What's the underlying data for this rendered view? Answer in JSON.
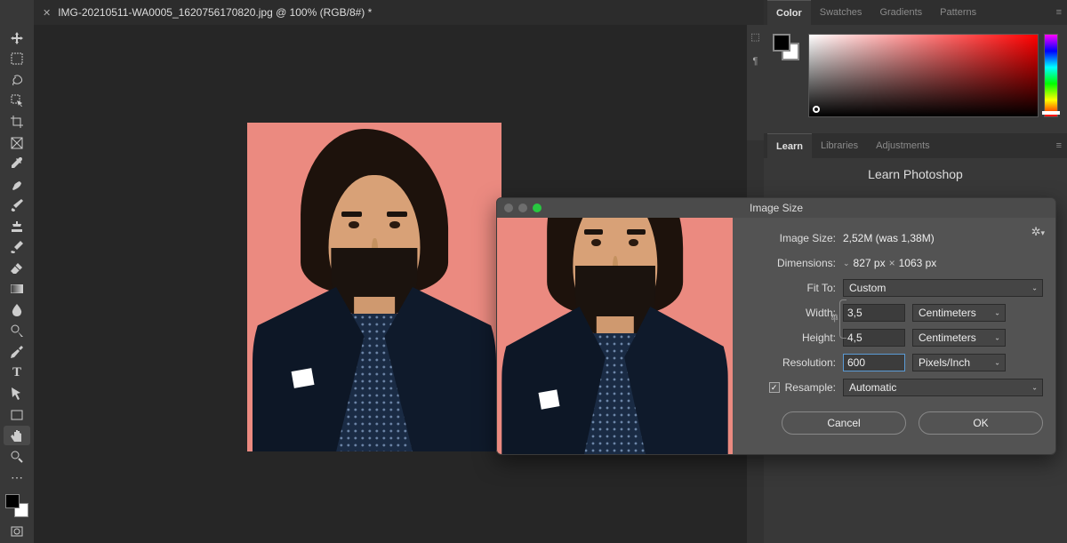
{
  "tab": {
    "title": "IMG-20210511-WA0005_1620756170820.jpg @ 100% (RGB/8#) *"
  },
  "panels": {
    "color": {
      "tabs": [
        "Color",
        "Swatches",
        "Gradients",
        "Patterns"
      ],
      "active": "Color"
    },
    "learn": {
      "tabs": [
        "Learn",
        "Libraries",
        "Adjustments"
      ],
      "active": "Learn",
      "heading": "Learn Photoshop"
    }
  },
  "dialog": {
    "title": "Image Size",
    "image_size_label": "Image Size:",
    "image_size_value": "2,52M (was 1,38M)",
    "dimensions_label": "Dimensions:",
    "dimensions_value_w": "827 px",
    "dimensions_value_h": "1063 px",
    "fit_to_label": "Fit To:",
    "fit_to_value": "Custom",
    "width_label": "Width:",
    "width_value": "3,5",
    "width_unit": "Centimeters",
    "height_label": "Height:",
    "height_value": "4,5",
    "height_unit": "Centimeters",
    "resolution_label": "Resolution:",
    "resolution_value": "600",
    "resolution_unit": "Pixels/Inch",
    "resample_label": "Resample:",
    "resample_value": "Automatic",
    "cancel": "Cancel",
    "ok": "OK"
  }
}
